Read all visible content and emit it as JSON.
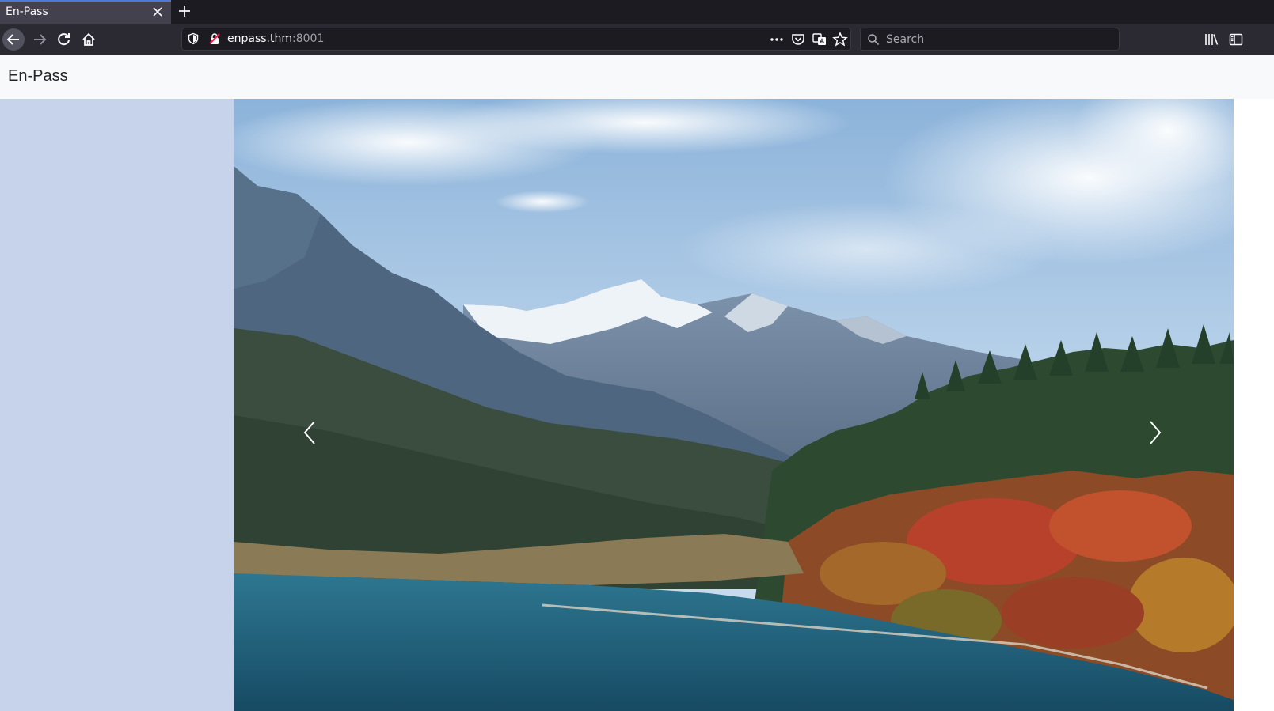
{
  "browser": {
    "tab": {
      "title": "En-Pass"
    },
    "url": {
      "host": "enpass.thm",
      "port": ":8001"
    },
    "search": {
      "placeholder": "Search"
    }
  },
  "page": {
    "brand": "En-Pass",
    "carousel": {
      "slide_description": "mountain lake landscape with autumn forest"
    }
  },
  "colors": {
    "chrome_dark": "#1c1b22",
    "toolbar": "#2b2a33",
    "header_bg": "#f8f9fa",
    "left_panel": "#c6d3eb"
  }
}
